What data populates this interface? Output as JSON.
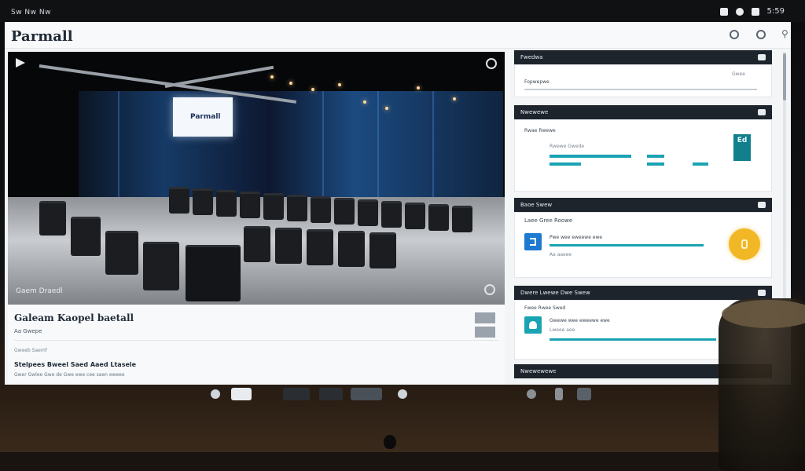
{
  "system": {
    "menu_text": "Sw Nw Nw",
    "clock": "5:59"
  },
  "app": {
    "title": "Parmall"
  },
  "media": {
    "screen_text": "Parmall",
    "caption": "Gaem Draedl"
  },
  "meta": {
    "title": "Galeam Kaopel baetall",
    "subtitle": "Aa Gwepe",
    "small": "Gweeb Saemf",
    "heading": "Stelpees Bweel Saed Aaed Ltasele",
    "line": "Gwer Gwlee Gwe de Gwe ewe cee saen eweee"
  },
  "cards": [
    {
      "heading": "Fwedwa",
      "row1": "Fopwepwe",
      "row1_right": "Gwee"
    },
    {
      "heading": "Nwewewe",
      "label": "Rwae Rwewe",
      "sublabel": "Rwewe Gwede",
      "tile_text": "Ed"
    },
    {
      "heading": "Baoe Swew",
      "label": "Laee Gree Roowe",
      "line1": "Pwe wee eweewe ewe",
      "line2": "Aa aaeee"
    },
    {
      "heading": "Dwere Lwewe Dwe Swew",
      "label": "Fwee Rwee Swed",
      "line1": "Gwewe wee eweewe ewe",
      "line2": "Lweee aee"
    },
    {
      "heading": "Nwewewewe"
    }
  ]
}
